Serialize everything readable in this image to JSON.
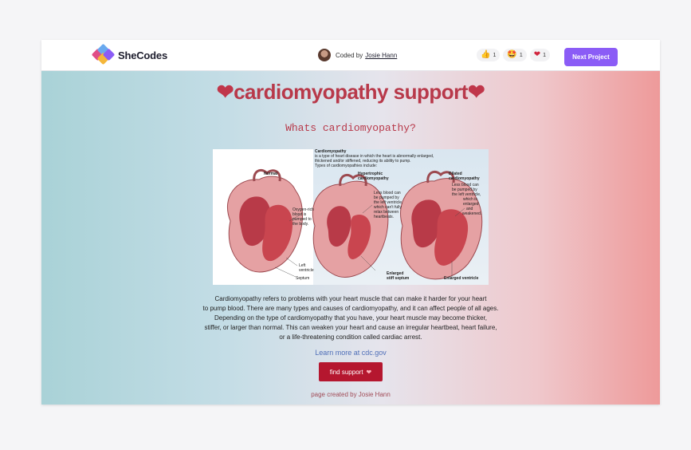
{
  "topbar": {
    "brand": "SheCodes",
    "coded_prefix": "Coded by",
    "author_link": "Josie Hann",
    "reactions": [
      {
        "icon": "thumbs-up-icon",
        "glyph": "👍",
        "count": "1"
      },
      {
        "icon": "star-eyes-icon",
        "glyph": "🤩",
        "count": "1"
      },
      {
        "icon": "heart-icon",
        "glyph": "❤",
        "count": "1"
      }
    ],
    "next_button": "Next Project"
  },
  "page": {
    "heart": "❤",
    "title": "cardiomyopathy support",
    "subtitle": "Whats cardiomyopathy?",
    "figure": {
      "heading": "Cardiomyopathy",
      "intro_1": "is a type of heart disease in which the heart is abnormally enlarged,",
      "intro_2": "thickened and/or stiffened, reducing its ability to pump.",
      "intro_3": "Types of cardiomyopathies include:",
      "label_normal": "Normal",
      "label_hyper_1": "Hypertrophic",
      "label_hyper_2": "cardiomyopathy",
      "label_dilated_1": "Dilated",
      "label_dilated_2": "cardiomyopathy",
      "oxygen_1": "Oxygen-rich",
      "oxygen_2": "blood is",
      "oxygen_3": "pumped to",
      "oxygen_4": "the body.",
      "less_1": "Less blood can",
      "less_2": "be pumped by",
      "less_3": "the left ventricle,",
      "less_4": "which can't fully",
      "less_5": "relax between",
      "less_6": "heartbeats.",
      "dil_1": "Less blood can",
      "dil_2": "be pumped by",
      "dil_3": "the left ventricle,",
      "dil_4": "which is",
      "dil_5": "enlarged",
      "dil_6": "and",
      "dil_7": "weakened.",
      "left_1": "Left",
      "left_2": "ventricle",
      "septum": "Septum",
      "enlarged_1": "Enlarged",
      "enlarged_2": "stiff septum",
      "enlarged_ventricle": "Enlarged ventricle"
    },
    "paragraph_lines": [
      "Cardiomyopathy refers to problems with your heart muscle that can make it harder for your heart",
      "to pump blood. There are many types and causes of cardiomyopathy, and it can affect people of all ages.",
      "Depending on the type of cardiomyopathy that you have, your heart muscle may become thicker,",
      "stiffer, or larger than normal. This can weaken your heart and cause an irregular heartbeat, heart failure,",
      "or a life-threatening condition called cardiac arrest."
    ],
    "learn_more": "Learn more at cdc.gov",
    "support_button": "find support",
    "support_icon": "❤",
    "credit": "page created by Josie Hann"
  },
  "colors": {
    "accent": "#8b5cf6",
    "title": "#b8394a",
    "button": "#b5172f",
    "link": "#4f6fb8"
  }
}
